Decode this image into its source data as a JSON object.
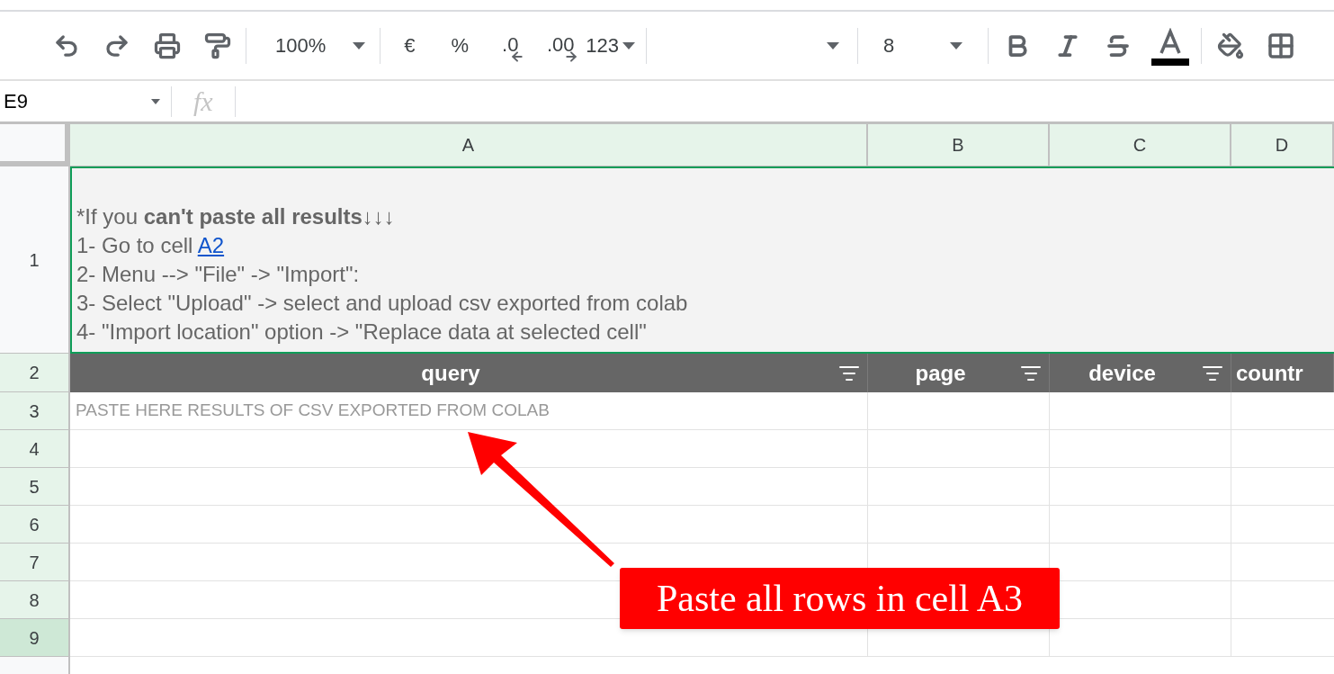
{
  "toolbar": {
    "zoom": "100%",
    "currency": "€",
    "percent": "%",
    "decrease_decimals": ".0",
    "increase_decimals": ".00",
    "number_format": "123",
    "font_size": "8"
  },
  "formula_bar": {
    "cell_ref": "E9",
    "fx": "fx"
  },
  "columns": [
    {
      "label": "A"
    },
    {
      "label": "B"
    },
    {
      "label": "C"
    },
    {
      "label": "D"
    }
  ],
  "note_cell": {
    "lines": [
      {
        "text": "*If you **can't paste all results**↓↓↓"
      },
      {
        "text": "1- Go to cell ",
        "link": "A2"
      },
      {
        "text": "2- Menu --> \"File\" -> \"Import\":"
      },
      {
        "text": "3- Select \"Upload\" -> select and upload csv exported from colab"
      },
      {
        "text": "4- \"Import location\" option -> \"Replace data at selected cell\""
      }
    ]
  },
  "header_cells": [
    {
      "text": "query",
      "filter": true
    },
    {
      "text": "page",
      "filter": true
    },
    {
      "text": "device",
      "filter": true
    },
    {
      "text": "countr",
      "filter": false
    }
  ],
  "rows": [
    {
      "number": "1",
      "highlighted": false,
      "selected": false
    },
    {
      "number": "2",
      "highlighted": true,
      "selected": false
    },
    {
      "number": "3",
      "highlighted": true,
      "selected": false,
      "cell_a": "PASTE HERE RESULTS OF CSV EXPORTED FROM COLAB"
    },
    {
      "number": "4",
      "highlighted": true,
      "selected": false
    },
    {
      "number": "5",
      "highlighted": true,
      "selected": false
    },
    {
      "number": "6",
      "highlighted": true,
      "selected": false
    },
    {
      "number": "7",
      "highlighted": true,
      "selected": false
    },
    {
      "number": "8",
      "highlighted": true,
      "selected": false
    },
    {
      "number": "9",
      "selected": true
    }
  ],
  "callout": {
    "text": "Paste all rows in cell A3"
  }
}
